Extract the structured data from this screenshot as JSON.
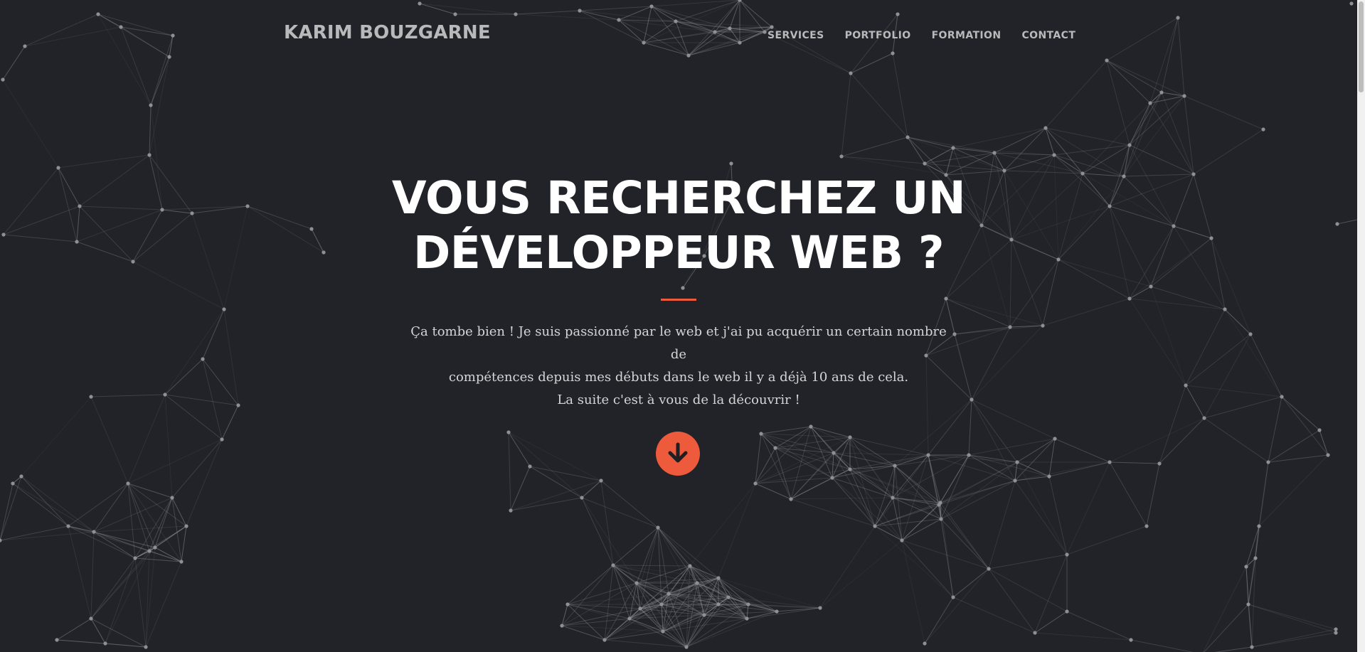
{
  "header": {
    "brand": "KARIM BOUZGARNE",
    "nav": [
      {
        "label": "SERVICES"
      },
      {
        "label": "PORTFOLIO"
      },
      {
        "label": "FORMATION"
      },
      {
        "label": "CONTACT"
      }
    ]
  },
  "hero": {
    "title_line1": "VOUS RECHERCHEZ UN",
    "title_line2": "DÉVELOPPEUR WEB ?",
    "text_line1": "Ça tombe bien ! Je suis passionné par le web et j'ai pu acquérir un certain nombre de",
    "text_line2": "compétences depuis mes débuts dans le web il y a déjà 10 ans de cela.",
    "text_line3": "La suite c'est à vous de la découvrir !",
    "scroll_icon": "arrow-down-icon"
  },
  "colors": {
    "background": "#212328",
    "accent": "#ed5a3c",
    "nav_text": "#b8b9bb",
    "title": "#ffffff"
  }
}
